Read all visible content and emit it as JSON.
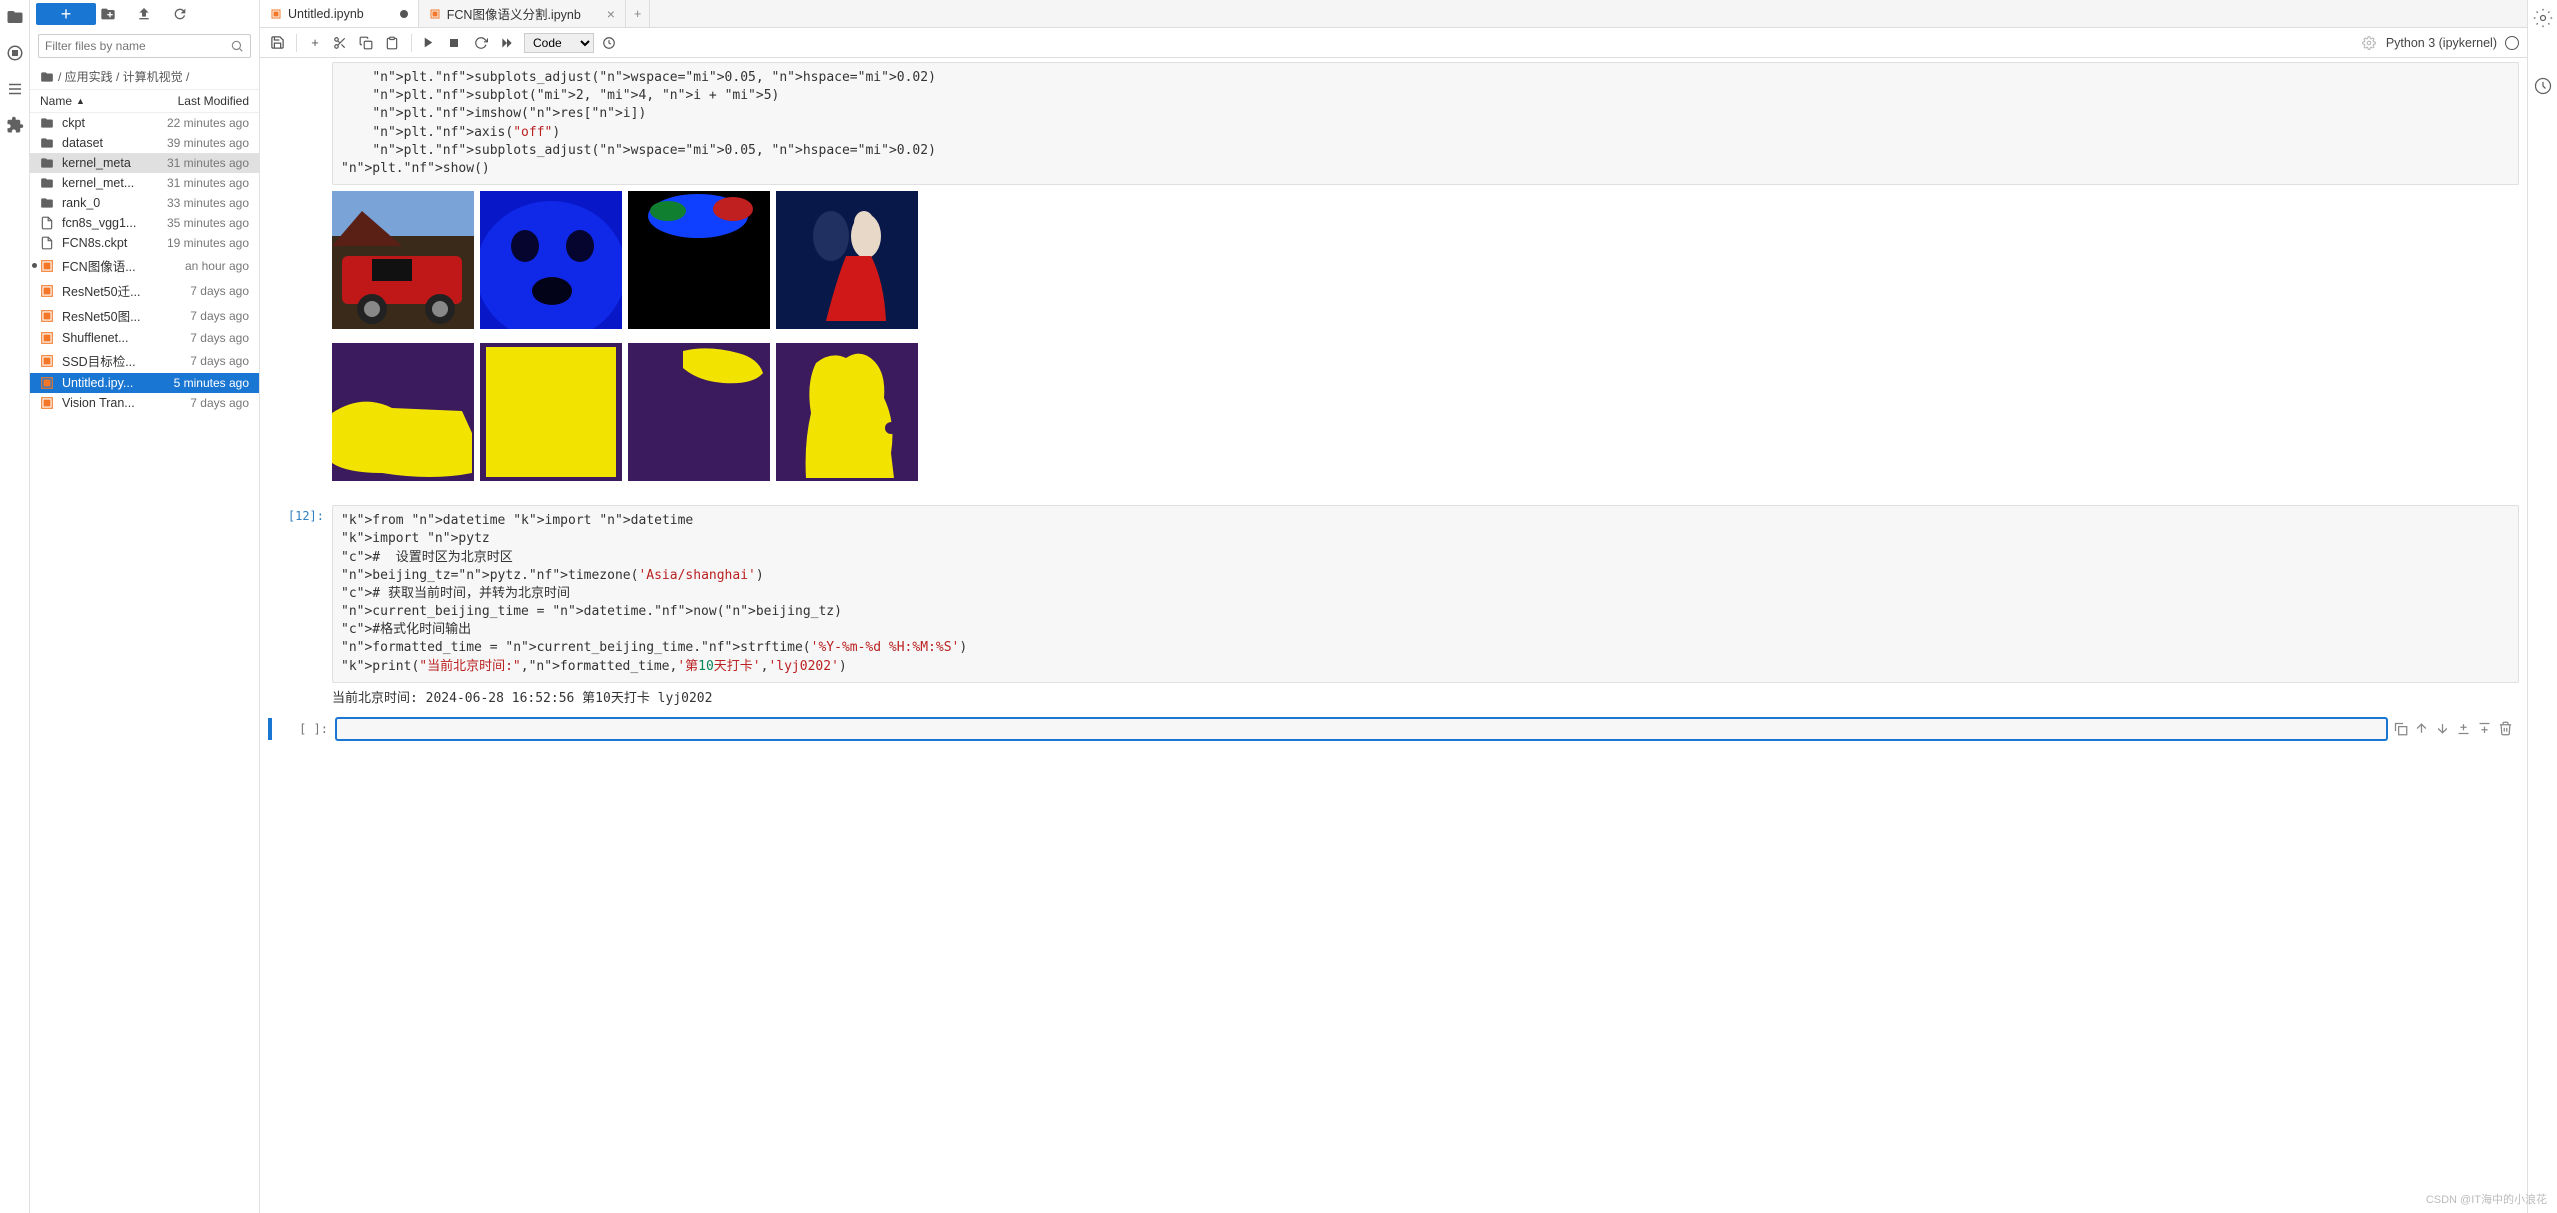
{
  "sidebar": {
    "filter_placeholder": "Filter files by name",
    "breadcrumb": "/ 应用实践 / 计算机视觉 /",
    "header_name": "Name",
    "header_modified": "Last Modified",
    "items": [
      {
        "icon": "folder",
        "name": "ckpt",
        "time": "22 minutes ago"
      },
      {
        "icon": "folder",
        "name": "dataset",
        "time": "39 minutes ago"
      },
      {
        "icon": "folder",
        "name": "kernel_meta",
        "time": "31 minutes ago",
        "hl": true
      },
      {
        "icon": "folder",
        "name": "kernel_met...",
        "time": "31 minutes ago"
      },
      {
        "icon": "folder",
        "name": "rank_0",
        "time": "33 minutes ago"
      },
      {
        "icon": "file",
        "name": "fcn8s_vgg1...",
        "time": "35 minutes ago"
      },
      {
        "icon": "file",
        "name": "FCN8s.ckpt",
        "time": "19 minutes ago"
      },
      {
        "icon": "notebook",
        "name": "FCN图像语...",
        "time": "an hour ago",
        "dot": true
      },
      {
        "icon": "notebook",
        "name": "ResNet50迁...",
        "time": "7 days ago"
      },
      {
        "icon": "notebook",
        "name": "ResNet50图...",
        "time": "7 days ago"
      },
      {
        "icon": "notebook",
        "name": "Shufflenet...",
        "time": "7 days ago"
      },
      {
        "icon": "notebook",
        "name": "SSD目标检...",
        "time": "7 days ago"
      },
      {
        "icon": "notebook",
        "name": "Untitled.ipy...",
        "time": "5 minutes ago",
        "sel": true
      },
      {
        "icon": "notebook",
        "name": "Vision Tran...",
        "time": "7 days ago"
      }
    ]
  },
  "tabs": [
    {
      "label": "Untitled.ipynb",
      "dirty": true,
      "active": true
    },
    {
      "label": "FCN图像语义分割.ipynb",
      "dirty": false,
      "active": false
    }
  ],
  "toolbar": {
    "celltype": "Code",
    "kernel": "Python 3 (ipykernel)"
  },
  "cells": {
    "code1_lines": [
      "    plt.subplots_adjust(wspace=0.05, hspace=0.02)",
      "    plt.subplot(2, 4, i + 5)",
      "    plt.imshow(res[i])",
      "    plt.axis(\"off\")",
      "    plt.subplots_adjust(wspace=0.05, hspace=0.02)",
      "plt.show()"
    ],
    "prompt2": "[12]:",
    "code2_lines": [
      "from datetime import datetime",
      "import pytz",
      "#  设置时区为北京时区",
      "beijing_tz=pytz.timezone('Asia/shanghai')",
      "# 获取当前时间，并转为北京时间",
      "current_beijing_time = datetime.now(beijing_tz)",
      "#格式化时间输出",
      "formatted_time = current_beijing_time.strftime('%Y-%m-%d %H:%M:%S')",
      "print(\"当前北京时间:\",formatted_time,'第10天打卡','lyj0202')"
    ],
    "output2": "当前北京时间: 2024-06-28 16:52:56 第10天打卡 lyj0202",
    "prompt3": "[ ]:"
  },
  "watermark": "CSDN @IT海中的小浪花"
}
